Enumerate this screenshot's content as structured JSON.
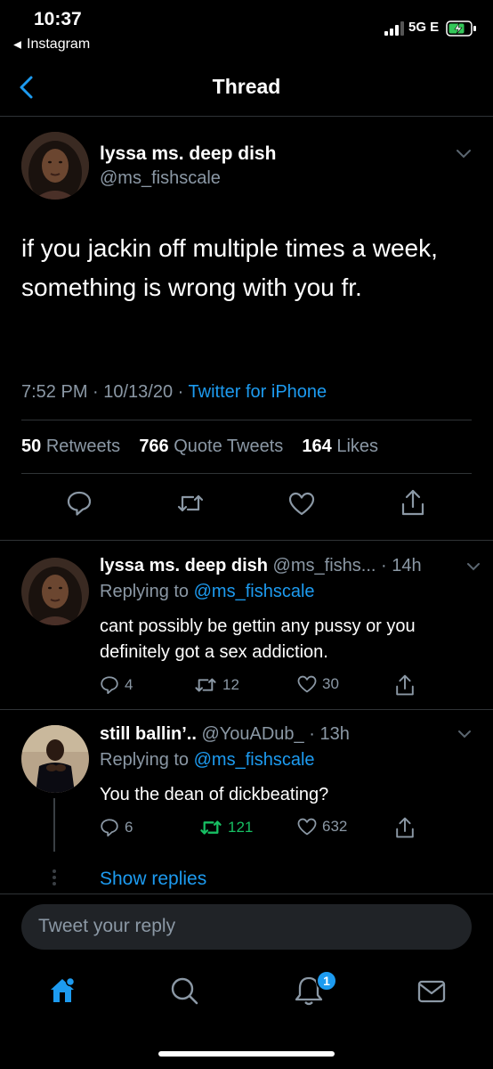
{
  "status_bar": {
    "time": "10:37",
    "back_app": "Instagram",
    "network": "5G E"
  },
  "header": {
    "title": "Thread"
  },
  "main_tweet": {
    "name": "lyssa ms. deep dish",
    "handle": "@ms_fishscale",
    "text": "if you jackin off multiple times a week, something is wrong with you fr.",
    "datetime": "7:52 PM · 10/13/20 · ",
    "source": "Twitter for iPhone",
    "retweets": "50",
    "retweets_label": "Retweets",
    "quotes": "766",
    "quotes_label": "Quote Tweets",
    "likes": "164",
    "likes_label": "Likes"
  },
  "replies": [
    {
      "name": "lyssa ms. deep dish",
      "handle_time": "@ms_fishs... · 14h",
      "replying_label": "Replying to ",
      "replying_to": "@ms_fishscale",
      "text": "cant possibly be gettin any pussy or you definitely got a sex addiction.",
      "replies": "4",
      "retweets": "12",
      "likes": "30"
    },
    {
      "name": "still ballin’..",
      "handle_time": "@YouADub_ · 13h",
      "replying_label": "Replying to ",
      "replying_to": "@ms_fishscale",
      "text": "You the dean of dickbeating?",
      "replies": "6",
      "retweets": "121",
      "likes": "632"
    }
  ],
  "show_replies": "Show replies",
  "composer": {
    "placeholder": "Tweet your reply"
  },
  "tab_bar": {
    "notification_count": "1"
  },
  "colors": {
    "accent": "#1d9bf0",
    "retweet_active": "#17bf63",
    "muted": "#8b98a5",
    "background": "#000000"
  }
}
